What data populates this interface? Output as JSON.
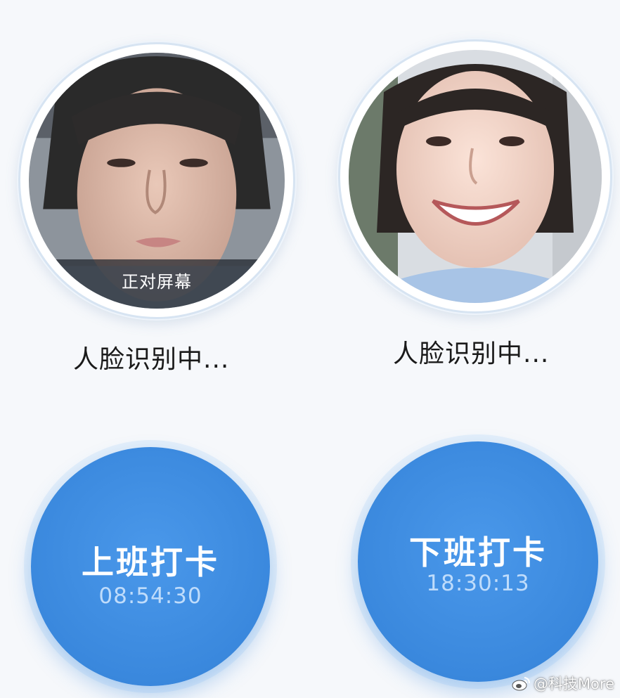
{
  "left": {
    "face_caption": "正对屏幕",
    "status": "人脸识别中...",
    "button_label": "上班打卡",
    "time": "08:54:30"
  },
  "right": {
    "status": "人脸识别中...",
    "button_label": "下班打卡",
    "time": "18:30:13"
  },
  "watermark": "@科技More",
  "colors": {
    "button_blue": "#3a88dd",
    "time_text": "#bfdcfb",
    "background": "#f6f8fb"
  }
}
